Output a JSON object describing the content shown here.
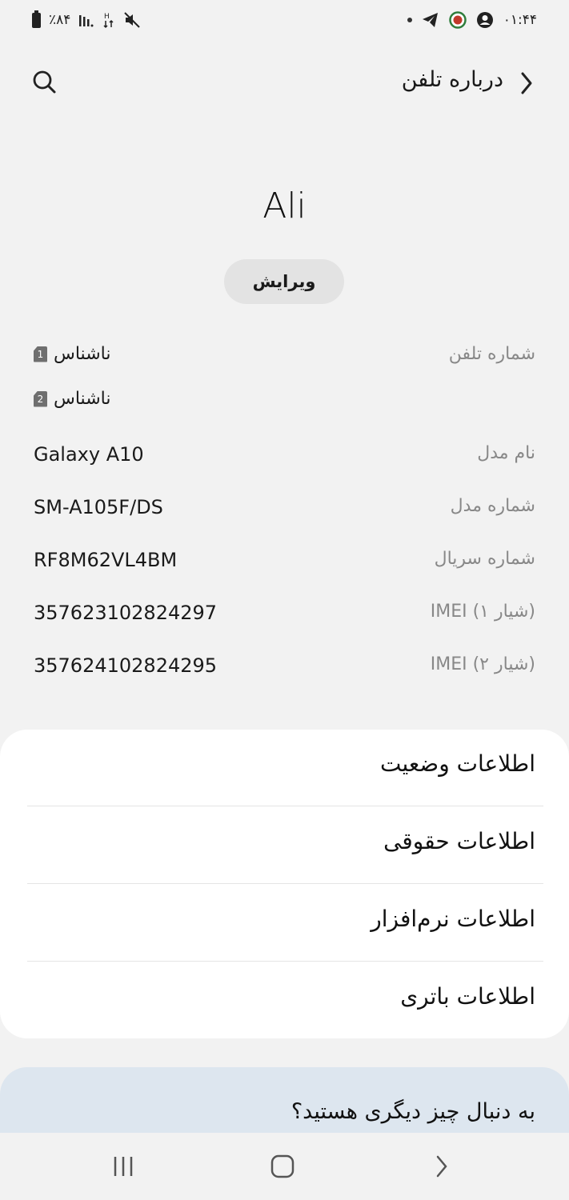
{
  "status_bar": {
    "battery_text": "٪۸۴",
    "time": "۰۱:۴۴"
  },
  "header": {
    "title": "درباره تلفن"
  },
  "profile": {
    "name": "Ali",
    "edit_label": "ویرایش"
  },
  "info": {
    "phone_label": "شماره تلفن",
    "sim1_badge": "1",
    "sim1_value": "ناشناس",
    "sim2_badge": "2",
    "sim2_value": "ناشناس",
    "rows": [
      {
        "label": "نام مدل",
        "value": "Galaxy A10"
      },
      {
        "label": "شماره مدل",
        "value": "SM-A105F/DS"
      },
      {
        "label": "شماره سریال",
        "value": "RF8M62VL4BM"
      },
      {
        "label": "IMEI (۱ شیار)",
        "value": "357623102824297"
      },
      {
        "label": "IMEI (۲ شیار)",
        "value": "357624102824295"
      }
    ]
  },
  "menu": [
    {
      "label": "اطلاعات وضعیت"
    },
    {
      "label": "اطلاعات حقوقی"
    },
    {
      "label": "اطلاعات نرم‌افزار"
    },
    {
      "label": "اطلاعات باتری"
    }
  ],
  "suggestion": {
    "text": "به دنبال چیز دیگری هستید؟"
  },
  "colors": {
    "background": "#f2f2f2",
    "card": "#ffffff",
    "suggestion_bg": "#dde6ef",
    "label_gray": "#888888"
  },
  "icons": [
    "battery-icon",
    "signal-icon",
    "data-icon",
    "mute-icon",
    "telegram-icon",
    "app-icon",
    "account-icon",
    "search-icon",
    "back-chevron-icon",
    "recents-icon",
    "home-icon",
    "nav-back-icon"
  ]
}
